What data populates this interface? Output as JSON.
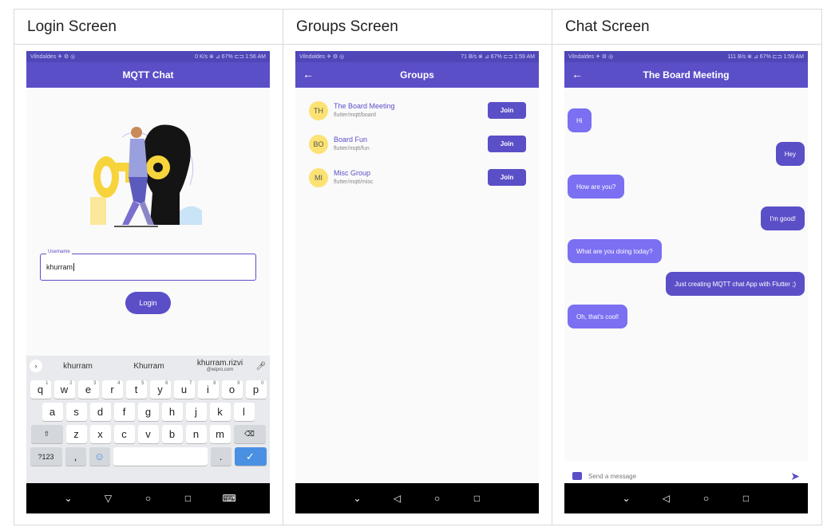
{
  "columns": {
    "login": {
      "title": "Login Screen"
    },
    "groups": {
      "title": "Groups Screen"
    },
    "chat": {
      "title": "Chat Screen"
    }
  },
  "login": {
    "status_left": "Vilndaldes ✈ ⚙ ◎",
    "status_right": "0 K/s ⊗ ⊿ 67% ⊏⊐ 1:56 AM",
    "app_title": "MQTT Chat",
    "username_label": "Username",
    "username_value": "khurram",
    "login_button": "Login",
    "keyboard": {
      "suggestions": [
        "khurram",
        "Khurram",
        "khurram.rizvi"
      ],
      "suggestion_sub": "@wipro.com",
      "row1": [
        "q",
        "w",
        "e",
        "r",
        "t",
        "y",
        "u",
        "i",
        "o",
        "p"
      ],
      "row1_nums": [
        "1",
        "2",
        "3",
        "4",
        "5",
        "6",
        "7",
        "8",
        "9",
        "0"
      ],
      "row2": [
        "a",
        "s",
        "d",
        "f",
        "g",
        "h",
        "j",
        "k",
        "l"
      ],
      "row3": [
        "z",
        "x",
        "c",
        "v",
        "b",
        "n",
        "m"
      ],
      "symbols_key": "?123",
      "comma_key": ",",
      "period_key": "."
    }
  },
  "groups": {
    "status_left": "Vilndaldes ✈ ⚙ ◎",
    "status_right": "71 B/s ⊗ ⊿ 67% ⊏⊐ 1:59 AM",
    "app_title": "Groups",
    "items": [
      {
        "initials": "TH",
        "name": "The Board Meeting",
        "topic": "flutter/mqtt/board",
        "button": "Join"
      },
      {
        "initials": "BO",
        "name": "Board Fun",
        "topic": "flutter/mqtt/fun",
        "button": "Join"
      },
      {
        "initials": "MI",
        "name": "Misc Group",
        "topic": "flutter/mqtt/misc",
        "button": "Join"
      }
    ]
  },
  "chat": {
    "status_left": "Vilndaldes ✈ ⚙ ◎",
    "status_right": "111 B/s ⊗ ⊿ 67% ⊏⊐ 1:59 AM",
    "app_title": "The Board Meeting",
    "messages": [
      {
        "text": "Hi",
        "direction": "in"
      },
      {
        "text": "Hey",
        "direction": "out"
      },
      {
        "text": "How are you?",
        "direction": "in"
      },
      {
        "text": "I'm good!",
        "direction": "out"
      },
      {
        "text": "What are you doing today?",
        "direction": "in"
      },
      {
        "text": "Just creating MQTT chat App with Flutter ;)",
        "direction": "out"
      },
      {
        "text": "Oh, that's cool!",
        "direction": "in"
      }
    ],
    "composer_placeholder": "Send a message"
  },
  "colors": {
    "primary": "#5b4fc7",
    "incoming_bubble": "#7b6ff2",
    "avatar": "#fbe272"
  }
}
